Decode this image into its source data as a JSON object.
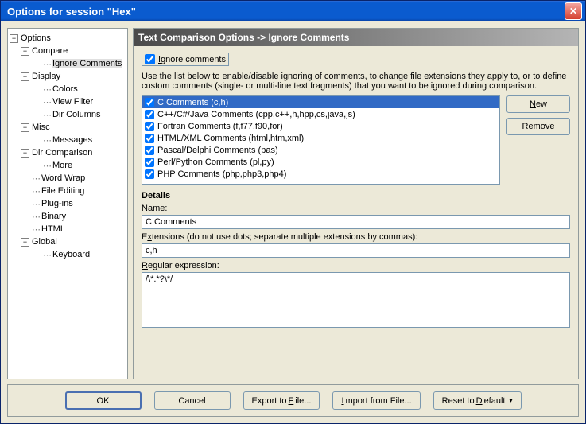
{
  "title": "Options for session \"Hex\"",
  "tree": {
    "root": "Options",
    "compare": "Compare",
    "ignore_comments": "Ignore Comments",
    "display": "Display",
    "colors": "Colors",
    "view_filter": "View Filter",
    "dir_columns": "Dir Columns",
    "misc": "Misc",
    "messages": "Messages",
    "dir_comparison": "Dir Comparison",
    "more": "More",
    "word_wrap": "Word Wrap",
    "file_editing": "File Editing",
    "plugins": "Plug-ins",
    "binary": "Binary",
    "html": "HTML",
    "global": "Global",
    "keyboard": "Keyboard"
  },
  "header": "Text Comparison Options -> Ignore Comments",
  "ignore_checkbox_pre": "I",
  "ignore_checkbox_rest": "gnore comments",
  "hint": "Use the list below to enable/disable ignoring of comments, to change file extensions they apply to, or to define custom comments (single- or multi-line text fragments) that you want to be ignored during comparison.",
  "list": [
    {
      "checked": true,
      "label": "C Comments (c,h)",
      "selected": true
    },
    {
      "checked": true,
      "label": "C++/C#/Java Comments (cpp,c++,h,hpp,cs,java,js)"
    },
    {
      "checked": true,
      "label": "Fortran Comments (f,f77,f90,for)"
    },
    {
      "checked": true,
      "label": "HTML/XML Comments (html,htm,xml)"
    },
    {
      "checked": true,
      "label": "Pascal/Delphi Comments (pas)"
    },
    {
      "checked": true,
      "label": "Perl/Python Comments (pl,py)"
    },
    {
      "checked": true,
      "label": "PHP Comments (php,php3,php4)"
    }
  ],
  "buttons": {
    "new_u": "N",
    "new_rest": "ew",
    "remove": "Remove"
  },
  "details": {
    "title": "Details",
    "name_lbl_pre": "N",
    "name_lbl_u": "a",
    "name_lbl_post": "me:",
    "name_val": "C Comments",
    "ext_lbl_pre": "E",
    "ext_lbl_u": "x",
    "ext_lbl_post": "tensions (do not use dots; separate multiple extensions by commas):",
    "ext_val": "c,h",
    "regex_lbl_u": "R",
    "regex_lbl_post": "egular expression:",
    "regex_val": "/\\*.*?\\*/"
  },
  "bottom": {
    "ok": "OK",
    "cancel": "Cancel",
    "export_pre": "Export to ",
    "export_u": "F",
    "export_post": "ile...",
    "import_u": "I",
    "import_post": "mport from File...",
    "reset_pre": "Reset to ",
    "reset_u": "D",
    "reset_post": "efault"
  }
}
